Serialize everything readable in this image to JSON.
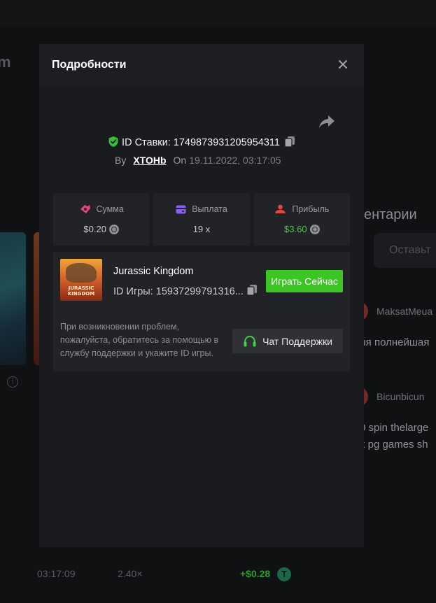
{
  "background": {
    "left_title_fragment": "m",
    "comments_title_fragment": "ентарии",
    "comment_input_placeholder_fragment": "Оставьт",
    "comments": [
      {
        "user": "MaksatMeua",
        "text": "йня полнейшая"
      },
      {
        "user": "Bicunbicun",
        "text": "0 spin thelarge",
        "text2": "k pg games sh"
      }
    ],
    "row": {
      "time": "03:17:09",
      "multiplier": "2.40×",
      "profit": "+$0.28",
      "coin_symbol": "T"
    }
  },
  "modal": {
    "title": "Подробности",
    "bet": {
      "id_label": "ID Ставки:",
      "id_value": "1749873931205954311",
      "by_label": "By",
      "user": "XTOHb",
      "on_label": "On",
      "date": "19.11.2022, 03:17:05"
    },
    "stats": [
      {
        "label": "Сумма",
        "value": "$0.20",
        "icon": "bet-amount-icon",
        "color": "#e0457b"
      },
      {
        "label": "Выплата",
        "value": "19 x",
        "icon": "wallet-icon",
        "color": "#8b5cf6"
      },
      {
        "label": "Прибыль",
        "value": "$3.60",
        "icon": "profit-icon",
        "color": "#e04848"
      }
    ],
    "game": {
      "name": "Jurassic Kingdom",
      "id_label": "ID Игры:",
      "id_value": "15937299791316...",
      "thumb_text": "JURASSIC KINGDOM",
      "play_label": "Играть Сейчас",
      "help_text": "При возникновении проблем, пожалуйста, обратитесь за помощью в службу поддержки и укажите ID игры.",
      "support_label": "Чат Поддержки"
    }
  },
  "colors": {
    "accent_green": "#3cc624",
    "profit_green": "#3fd13f",
    "shield_green": "#31c23a"
  }
}
